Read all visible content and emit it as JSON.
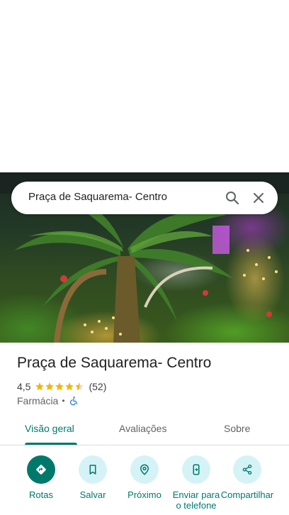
{
  "search": {
    "query": "Praça de Saquarema- Centro"
  },
  "place": {
    "title": "Praça de Saquarema- Centro",
    "rating": "4,5",
    "star_count": 4.5,
    "reviews": "(52)",
    "category": "Farmácia",
    "separator": "•"
  },
  "tabs": [
    {
      "label": "Visão geral",
      "active": true
    },
    {
      "label": "Avaliações",
      "active": false
    },
    {
      "label": "Sobre",
      "active": false
    }
  ],
  "actions": [
    {
      "label": "Rotas",
      "icon": "directions-icon"
    },
    {
      "label": "Salvar",
      "icon": "bookmark-icon"
    },
    {
      "label": "Próximo",
      "icon": "nearby-icon"
    },
    {
      "label": "Enviar para o telefone",
      "icon": "send-to-phone-icon"
    },
    {
      "label": "Compartilhar",
      "icon": "share-icon"
    }
  ],
  "colors": {
    "accent": "#00796b",
    "action_bg": "#d5f3f7",
    "star": "#f4b400"
  }
}
